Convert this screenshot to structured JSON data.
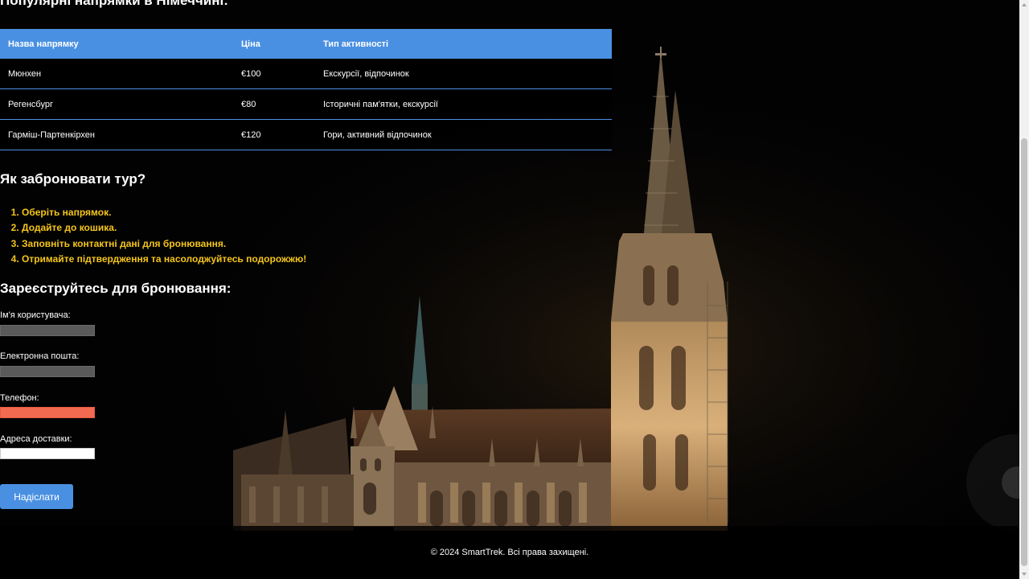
{
  "page": {
    "cut_heading": "Популярні напрямки в Німеччині:"
  },
  "table": {
    "headers": [
      "Назва напрямку",
      "Ціна",
      "Тип активності"
    ],
    "rows": [
      [
        "Мюнхен",
        "€100",
        "Екскурсії, відпочинок"
      ],
      [
        "Регенсбург",
        "€80",
        "Історичні пам'ятки, екскурсії"
      ],
      [
        "Гарміш-Партенкірхен",
        "€120",
        "Гори, активний відпочинок"
      ]
    ]
  },
  "how_to_book": {
    "title": "Як забронювати тур?",
    "steps": [
      "Оберіть напрямок.",
      "Додайте до кошика.",
      "Заповніть контактні дані для бронювання.",
      "Отримайте підтвердження та насолоджуйтесь подорожжю!"
    ]
  },
  "register": {
    "title": "Зареєструйтесь для бронювання:",
    "fields": [
      {
        "label": "Ім'я користувача:",
        "value": ""
      },
      {
        "label": "Електронна пошта:",
        "value": ""
      },
      {
        "label": "Телефон:",
        "value": ""
      },
      {
        "label": "Адреса доставки:",
        "value": ""
      }
    ],
    "submit_label": "Надіслати"
  },
  "footer": {
    "text": "© 2024 SmartTrek. Всі права захищені."
  },
  "colors": {
    "accent": "#4a90e2",
    "steps_text": "#f5c518",
    "phone_field": "#f26a50",
    "background": "#020203"
  },
  "icons": {
    "scroll_up": "chevron-up-icon",
    "scroll_down": "chevron-down-icon"
  }
}
